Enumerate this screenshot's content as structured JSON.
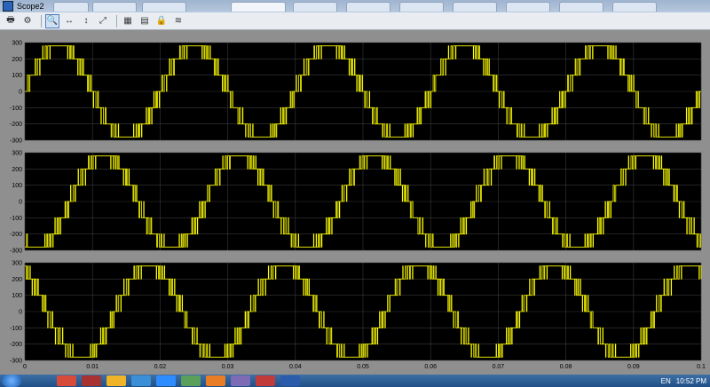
{
  "window": {
    "title": "Scope2"
  },
  "status_text": "",
  "toolbar": {
    "buttons": [
      {
        "name": "print-icon",
        "glyph": "🖶"
      },
      {
        "name": "parameters-icon",
        "glyph": "⚙"
      },
      {
        "name": "zoom-icon",
        "glyph": "🔍",
        "active": true
      },
      {
        "name": "zoom-x-icon",
        "glyph": "↔"
      },
      {
        "name": "zoom-y-icon",
        "glyph": "↕"
      },
      {
        "name": "autoscale-icon",
        "glyph": "⤢"
      },
      {
        "name": "save-axes-icon",
        "glyph": "▦"
      },
      {
        "name": "restore-axes-icon",
        "glyph": "▤"
      },
      {
        "name": "lock-icon",
        "glyph": "🔒"
      },
      {
        "name": "signal-selection-icon",
        "glyph": "≋"
      }
    ]
  },
  "chart_data": {
    "type": "line",
    "colors": {
      "background": "#000000",
      "trace": "#ffff00",
      "grid": "#3a3a3a",
      "frame": "#8f8f8f"
    },
    "x": {
      "min": 0,
      "max": 0.1,
      "ticks": [
        "0",
        "0.01",
        "0.02",
        "0.03",
        "0.04",
        "0.05",
        "0.06",
        "0.07",
        "0.08",
        "0.09",
        "0.1"
      ]
    },
    "y": {
      "min": -300,
      "max": 300,
      "ticks": [
        "300",
        "200",
        "100",
        "0",
        "-100",
        "-200",
        "-300"
      ]
    },
    "grid": true,
    "signal": {
      "frequency_hz": 50,
      "amplitude": 280,
      "levels": [
        0,
        100,
        200,
        280
      ]
    },
    "subplots": [
      {
        "phase_deg": 0
      },
      {
        "phase_deg": -120
      },
      {
        "phase_deg": 120
      }
    ]
  },
  "taskbar": {
    "clock": "10:52 PM",
    "lang": "EN"
  }
}
